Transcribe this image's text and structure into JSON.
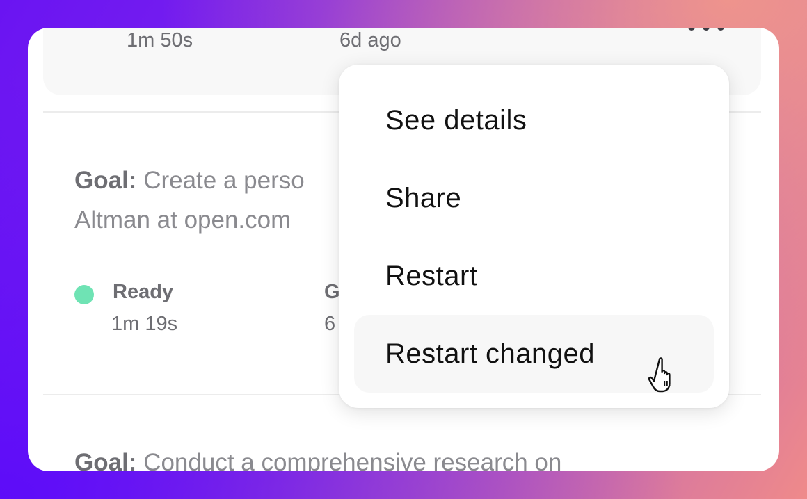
{
  "top_task": {
    "duration": "1m 50s",
    "time_ago": "6d ago"
  },
  "task_2": {
    "goal_label": "Goal:",
    "goal_line1": "Create a perso",
    "goal_line2": "Altman at open.com",
    "status": "Ready",
    "status_color": "#6fe3b4",
    "duration": "1m 19s",
    "col2_label_partial": "G",
    "col2_value_partial": "6"
  },
  "task_3": {
    "goal_label": "Goal:",
    "goal_text": "Conduct a comprehensive research on"
  },
  "context_menu": {
    "items": [
      {
        "label": "See details"
      },
      {
        "label": "Share"
      },
      {
        "label": "Restart"
      },
      {
        "label": "Restart changed",
        "state": "hover"
      }
    ]
  },
  "icons": {
    "more": "more-options-icon",
    "cursor": "hand-pointer-cursor"
  }
}
